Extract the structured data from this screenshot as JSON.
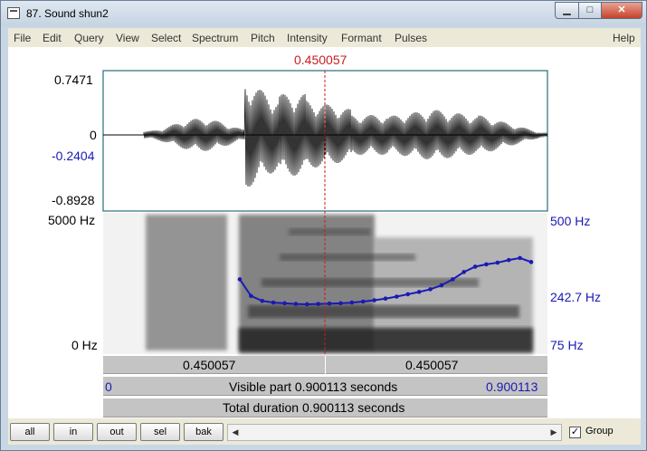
{
  "window": {
    "title": "87. Sound shun2",
    "controls": {
      "minimize": "▁",
      "maximize": "□",
      "close": "✕"
    }
  },
  "menu": [
    "File",
    "Edit",
    "Query",
    "View",
    "Select",
    "Spectrum",
    "Pitch",
    "Intensity",
    "Formant",
    "Pulses",
    "Help"
  ],
  "cursor": {
    "time_label": "0.450057"
  },
  "waveform": {
    "y_max": "0.7471",
    "y_zero": "0",
    "y_cursor": "-0.2404",
    "y_min": "-0.8928"
  },
  "spectrogram": {
    "freq_top": "5000 Hz",
    "freq_bottom": "0 Hz",
    "pitch_top": "500 Hz",
    "pitch_cursor": "242.7 Hz",
    "pitch_bottom": "75 Hz"
  },
  "bars": {
    "left_segment": "0.450057",
    "right_segment": "0.450057",
    "visible_start": "0",
    "visible_text": "Visible part 0.900113 seconds",
    "visible_end": "0.900113",
    "total_text": "Total duration 0.900113 seconds"
  },
  "toolbar": {
    "buttons": [
      "all",
      "in",
      "out",
      "sel",
      "bak"
    ],
    "scroll_left": "◀",
    "scroll_right": "▶",
    "group_checked": "✓",
    "group_label": "Group"
  },
  "colors": {
    "cursor": "#c81e1e",
    "pitch": "#1a1ab4",
    "axis_label_blue": "#1a1ab4"
  },
  "chart_data": {
    "type": "line",
    "series": [
      {
        "x": [
          0.0,
          0.02,
          0.04,
          0.06,
          0.08,
          0.1,
          0.12,
          0.14,
          0.16,
          0.18,
          0.2,
          0.22,
          0.24,
          0.26,
          0.28,
          0.3,
          0.32,
          0.34,
          0.36,
          0.38,
          0.4,
          0.42,
          0.44,
          0.46,
          0.48,
          0.5,
          0.52
        ],
        "values": [
          300,
          250,
          235,
          230,
          228,
          226,
          225,
          226,
          227,
          228,
          230,
          233,
          237,
          242,
          248,
          255,
          262,
          270,
          282,
          300,
          322,
          338,
          345,
          350,
          358,
          364,
          352
        ]
      }
    ],
    "xlim": [
      0.0,
      0.52
    ],
    "ylim": [
      75,
      500
    ],
    "yticks": [
      "500 Hz",
      "242.7 Hz",
      "75 Hz"
    ]
  }
}
